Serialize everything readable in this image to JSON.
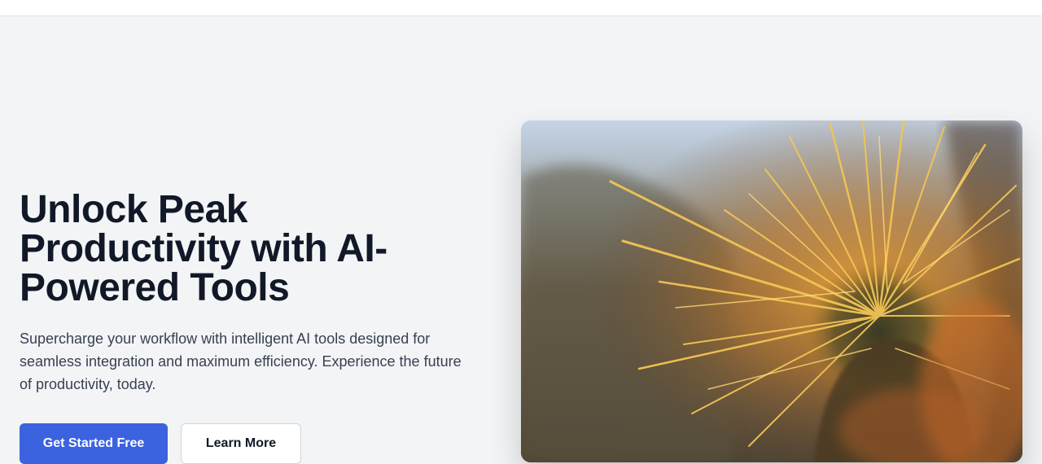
{
  "hero": {
    "headline": "Unlock Peak Productivity with AI-Powered Tools",
    "subtext": "Supercharge your workflow with intelligent AI tools designed for seamless integration and maximum efficiency. Experience the future of productivity, today.",
    "primary_cta": "Get Started Free",
    "secondary_cta": "Learn More",
    "image_subject": "close-up-golden-cactus-spines"
  },
  "colors": {
    "background": "#f3f4f6",
    "headline": "#111827",
    "body_text": "#374151",
    "primary": "#3b63e0",
    "secondary_border": "#d1d5db"
  }
}
